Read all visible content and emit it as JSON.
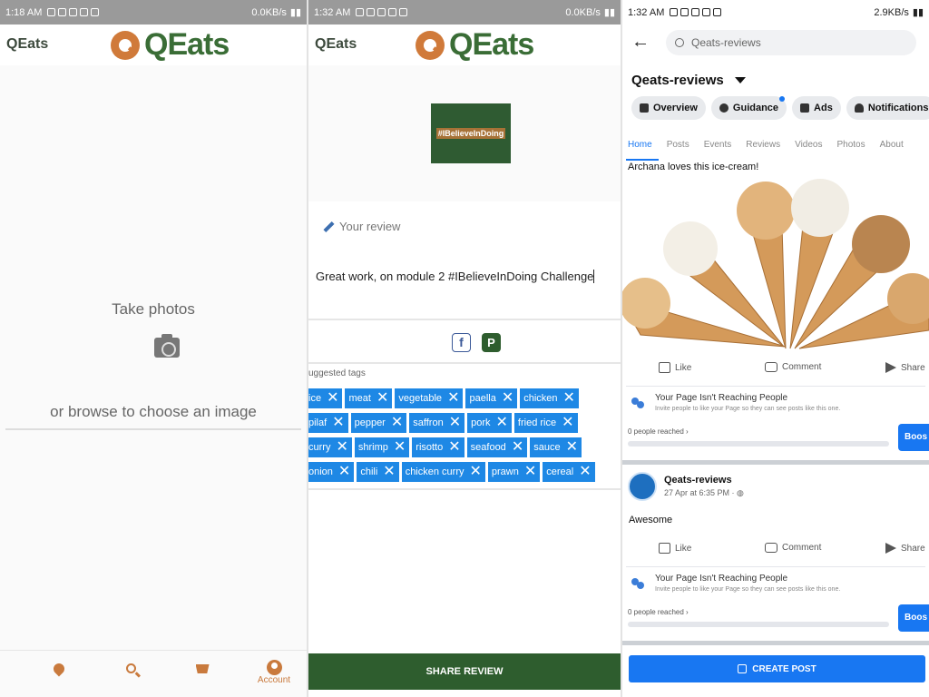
{
  "panel1": {
    "status_time": "1:18 AM",
    "status_speed": "0.0KB/s",
    "app_title": "QEats",
    "logo_text": "QEats",
    "take_photos": "Take photos",
    "browse": "or browse to choose an image",
    "nav": {
      "account_label": "Account"
    },
    "colors": {
      "accent": "#c97a3d",
      "brand_green": "#3a6d36"
    }
  },
  "panel2": {
    "status_time": "1:32 AM",
    "status_speed": "0.0KB/s",
    "app_title": "QEats",
    "logo_text": "QEats",
    "thumbnail_text": "#IBelieveInDoing",
    "review_label": "Your review",
    "review_text": "Great work, on module 2 #IBelieveInDoing Challenge",
    "tags_label": "uggested tags",
    "tag_rows": [
      [
        "ice",
        "meat",
        "vegetable",
        "paella",
        "chicken"
      ],
      [
        "pilaf",
        "pepper",
        "saffron",
        "pork",
        "fried rice"
      ],
      [
        "curry",
        "shrimp",
        "risotto",
        "seafood",
        "sauce"
      ],
      [
        "onion",
        "chili",
        "chicken curry",
        "prawn",
        "cereal"
      ]
    ],
    "share_button": "SHARE REVIEW",
    "colors": {
      "tag_blue": "#1e88e5",
      "share_green": "#2e5d2e"
    }
  },
  "panel3": {
    "status_time": "1:32 AM",
    "status_speed": "2.9KB/s",
    "search_text": "Qeats-reviews",
    "page_name": "Qeats-reviews",
    "chips": [
      "Overview",
      "Guidance",
      "Ads",
      "Notifications"
    ],
    "tabs": [
      "Home",
      "Posts",
      "Events",
      "Reviews",
      "Videos",
      "Photos",
      "About"
    ],
    "post1_caption": "Archana loves this ice-cream!",
    "actions": {
      "like": "Like",
      "comment": "Comment",
      "share": "Share"
    },
    "reach": {
      "title": "Your Page Isn't Reaching People",
      "subtitle": "Invite people to like your Page so they can see posts like this one.",
      "reached": "0 people reached",
      "boost": "Boos"
    },
    "post2": {
      "name": "Qeats-reviews",
      "date": "27 Apr at 6:35 PM · ",
      "text": "Awesome"
    },
    "create_post": "CREATE POST",
    "colors": {
      "fb_blue": "#1877f2"
    }
  }
}
